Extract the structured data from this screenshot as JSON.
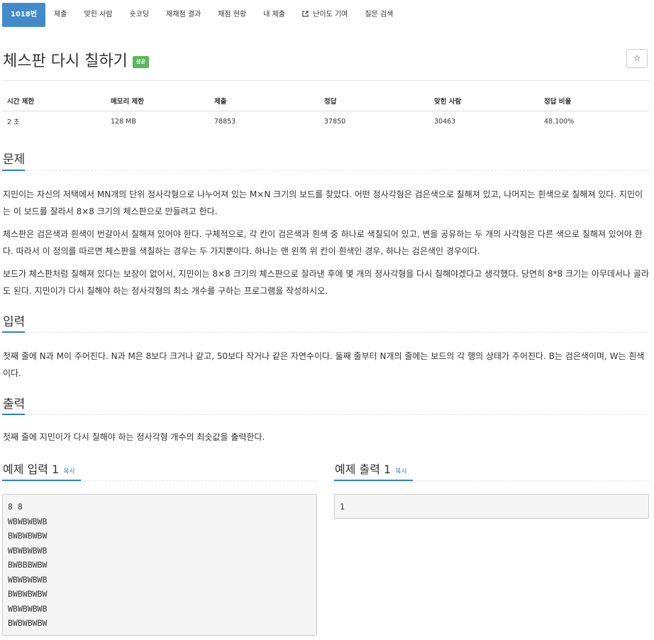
{
  "tabs": [
    {
      "label": "1018번",
      "active": true
    },
    {
      "label": "제출"
    },
    {
      "label": "맞힌 사람"
    },
    {
      "label": "숏코딩"
    },
    {
      "label": "재채점 결과"
    },
    {
      "label": "채점 현황"
    },
    {
      "label": "내 제출"
    },
    {
      "label": "난이도 기여",
      "icon": "external-link-icon"
    },
    {
      "label": "질문 검색"
    }
  ],
  "problem": {
    "title": "체스판 다시 칠하기",
    "badge": "성공",
    "star_glyph": "☆"
  },
  "info_table": {
    "headers": [
      "시간 제한",
      "메모리 제한",
      "제출",
      "정답",
      "맞힌 사람",
      "정답 비율"
    ],
    "values": [
      "2 초",
      "128 MB",
      "78853",
      "37850",
      "30463",
      "48.100%"
    ]
  },
  "sections": {
    "problem": {
      "heading": "문제",
      "paragraphs": [
        "지민이는 자신의 저택에서 MN개의 단위 정사각형으로 나누어져 있는 M×N 크기의 보드를 찾았다. 어떤 정사각형은 검은색으로 칠해져 있고, 나머지는 흰색으로 칠해져 있다. 지민이는 이 보드를 잘라서 8×8 크기의 체스판으로 만들려고 한다.",
        "체스판은 검은색과 흰색이 번갈아서 칠해져 있어야 한다. 구체적으로, 각 칸이 검은색과 흰색 중 하나로 색칠되어 있고, 변을 공유하는 두 개의 사각형은 다른 색으로 칠해져 있어야 한다. 따라서 이 정의를 따르면 체스판을 색칠하는 경우는 두 가지뿐이다. 하나는 맨 왼쪽 위 칸이 흰색인 경우, 하나는 검은색인 경우이다.",
        "보드가 체스판처럼 칠해져 있다는 보장이 없어서, 지민이는 8×8 크기의 체스판으로 잘라낸 후에 몇 개의 정사각형을 다시 칠해야겠다고 생각했다. 당연히 8*8 크기는 아무데서나 골라도 된다. 지민이가 다시 칠해야 하는 정사각형의 최소 개수를 구하는 프로그램을 작성하시오."
      ]
    },
    "input": {
      "heading": "입력",
      "text": "첫째 줄에 N과 M이 주어진다. N과 M은 8보다 크거나 같고, 50보다 작거나 같은 자연수이다. 둘째 줄부터 N개의 줄에는 보드의 각 행의 상태가 주어진다. B는 검은색이며, W는 흰색이다."
    },
    "output": {
      "heading": "출력",
      "text": "첫째 줄에 지민이가 다시 칠해야 하는 정사각형 개수의 최솟값을 출력한다."
    }
  },
  "samples": {
    "input": {
      "heading": "예제 입력 1",
      "copy_label": "복사",
      "content": "8 8\nWBWBWBWB\nBWBWBWBW\nWBWBWBWB\nBWBBBWBW\nWBWBWBWB\nBWBWBWBW\nWBWBWBWB\nBWBWBWBW"
    },
    "output": {
      "heading": "예제 출력 1",
      "copy_label": "복사",
      "content": "1"
    }
  },
  "colors": {
    "accent": "#428bca",
    "success": "#5cb85c",
    "underline": "#2f7fc1"
  }
}
